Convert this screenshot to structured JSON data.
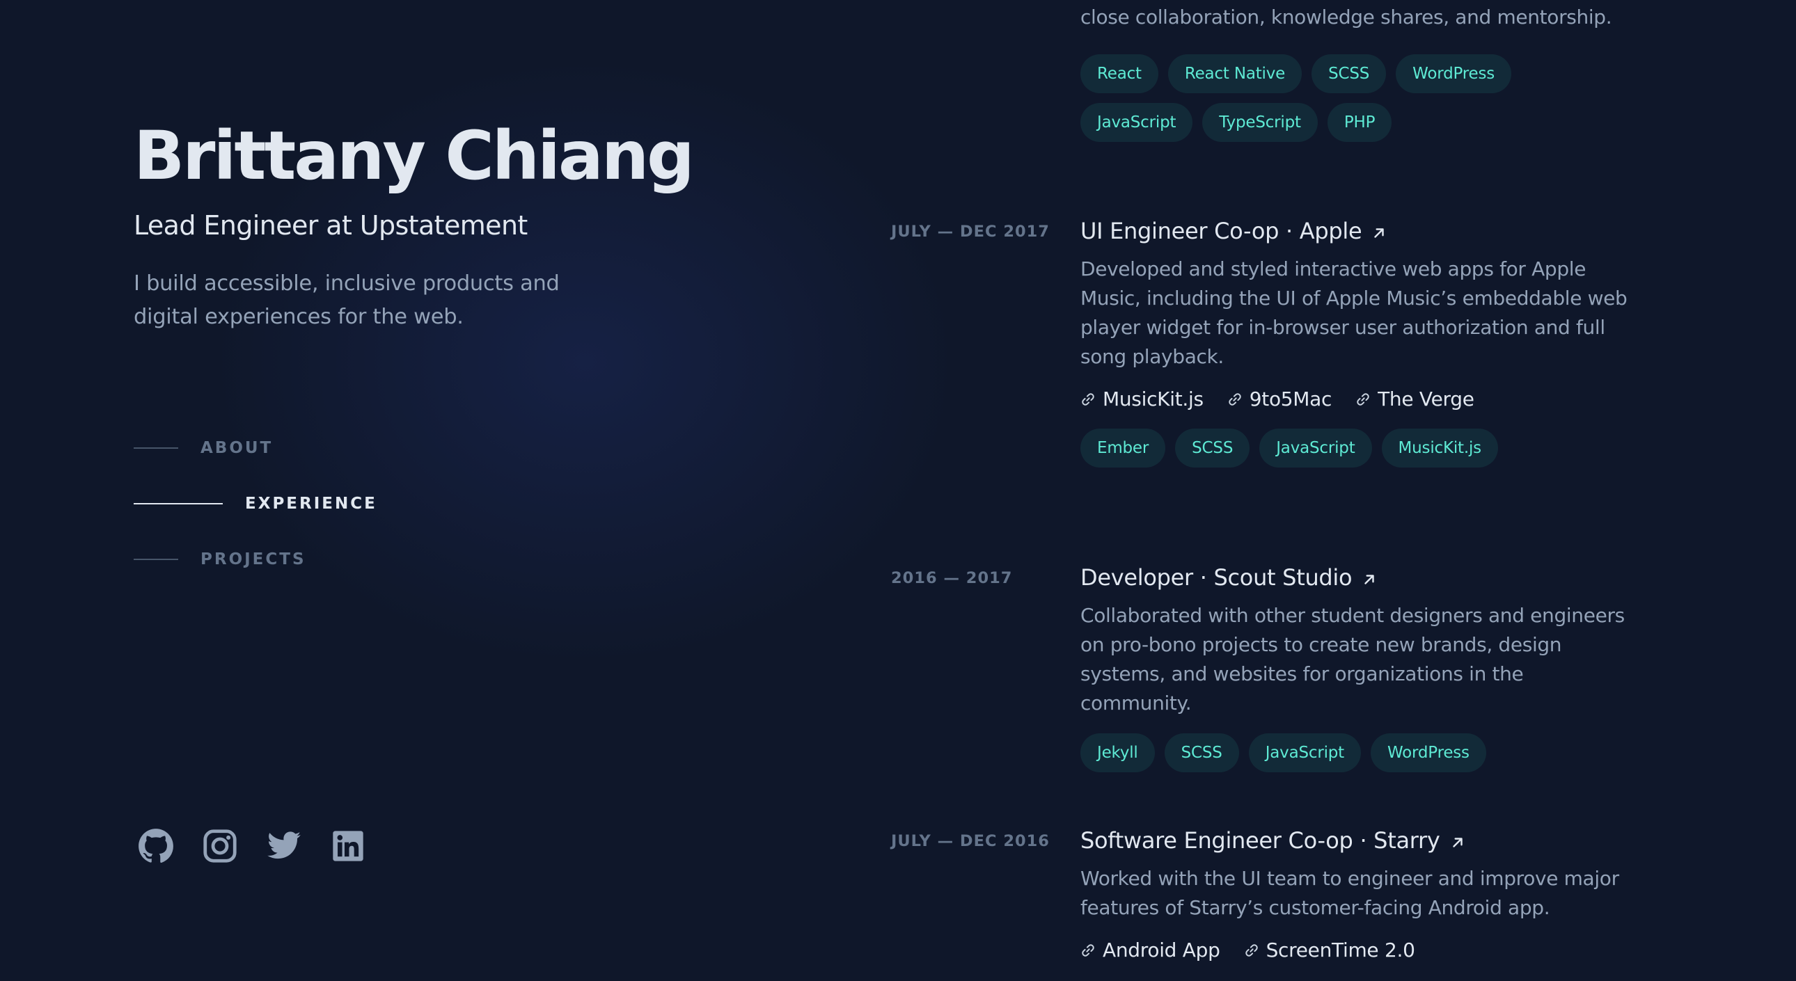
{
  "header": {
    "name": "Brittany Chiang",
    "role": "Lead Engineer at Upstatement",
    "tagline": "I build accessible, inclusive products and digital experiences for the web."
  },
  "nav": {
    "items": [
      {
        "label": "ABOUT",
        "active": false
      },
      {
        "label": "EXPERIENCE",
        "active": true
      },
      {
        "label": "PROJECTS",
        "active": false
      }
    ]
  },
  "socials": [
    {
      "icon": "github-icon"
    },
    {
      "icon": "instagram-icon"
    },
    {
      "icon": "twitter-icon"
    },
    {
      "icon": "linkedin-icon"
    }
  ],
  "experience": {
    "previous": {
      "desc_tail": "close collaboration, knowledge shares, and mentorship.",
      "tags": [
        "React",
        "React Native",
        "SCSS",
        "WordPress",
        "JavaScript",
        "TypeScript",
        "PHP"
      ]
    },
    "items": [
      {
        "date": "JULY — DEC 2017",
        "title": "UI Engineer Co-op · Apple",
        "desc": "Developed and styled interactive web apps for Apple Music, including the UI of Apple Music’s embeddable web player widget for in-browser user authorization and full song playback.",
        "links": [
          "MusicKit.js",
          "9to5Mac",
          "The Verge"
        ],
        "tags": [
          "Ember",
          "SCSS",
          "JavaScript",
          "MusicKit.js"
        ]
      },
      {
        "date": "2016 — 2017",
        "title": "Developer · Scout Studio",
        "desc": "Collaborated with other student designers and engineers on pro-bono projects to create new brands, design systems, and websites for organizations in the community.",
        "links": [],
        "tags": [
          "Jekyll",
          "SCSS",
          "JavaScript",
          "WordPress"
        ]
      },
      {
        "date": "JULY — DEC 2016",
        "title": "Software Engineer Co-op · Starry",
        "desc": "Worked with the UI team to engineer and improve major features of Starry’s customer-facing Android app.",
        "links": [
          "Android App",
          "ScreenTime 2.0"
        ],
        "tags": []
      }
    ]
  },
  "colors": {
    "background": "#0f172a",
    "heading": "#e2e8f0",
    "body": "#94a3b8",
    "muted": "#64748b",
    "accent": "#5eead4",
    "tag_bg": "rgba(45,212,191,0.10)"
  }
}
